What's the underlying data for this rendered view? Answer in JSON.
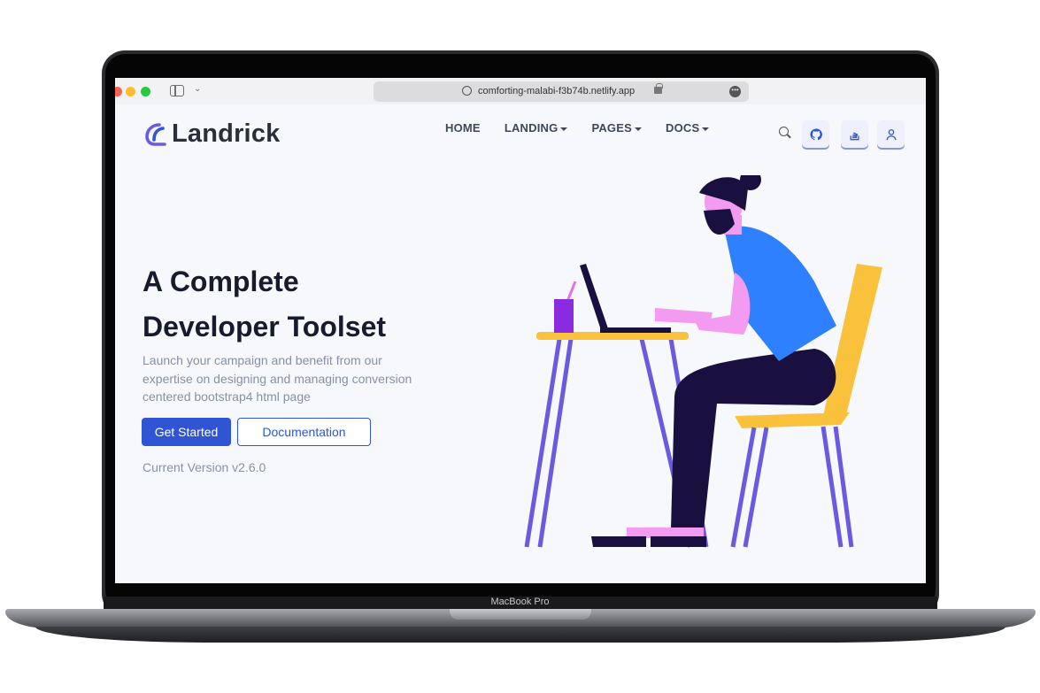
{
  "browser": {
    "url": "comforting-malabi-f3b74b.netlify.app"
  },
  "device": {
    "label": "MacBook Pro"
  },
  "site": {
    "brand": "Landrick",
    "brand_color": "#2f55d4",
    "nav": [
      {
        "label": "HOME",
        "dropdown": false
      },
      {
        "label": "LANDING",
        "dropdown": true
      },
      {
        "label": "PAGES",
        "dropdown": true
      },
      {
        "label": "DOCS",
        "dropdown": true
      }
    ],
    "header_icons": [
      "search-icon",
      "github-icon",
      "stackoverflow-icon",
      "user-icon"
    ]
  },
  "hero": {
    "title_line1": "A Complete",
    "title_line2": "Developer Toolset",
    "description": "Launch your campaign and benefit from our expertise on designing and managing conversion centered bootstrap4 html page",
    "primary_button": "Get Started",
    "secondary_button": "Documentation",
    "version": "Current Version v2.6.0"
  }
}
